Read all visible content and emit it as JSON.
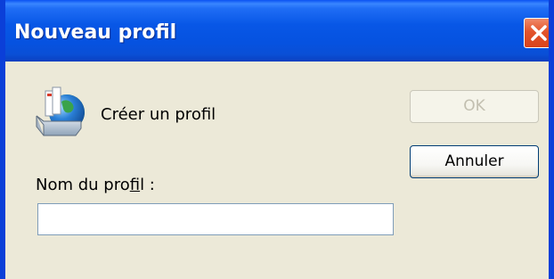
{
  "window": {
    "title": "Nouveau profil"
  },
  "header": {
    "icon": "mail-profile-icon",
    "label": "Créer un profil"
  },
  "field": {
    "label_before": "Nom du pro",
    "label_accel": "f",
    "label_after": "il :",
    "value": ""
  },
  "buttons": {
    "ok_label": "OK",
    "cancel_label": "Annuler"
  },
  "colors": {
    "titlebar": "#0652e0",
    "dialog_bg": "#ece9d8",
    "close_button": "#e2542c",
    "disabled_text": "#c2bfb0"
  }
}
